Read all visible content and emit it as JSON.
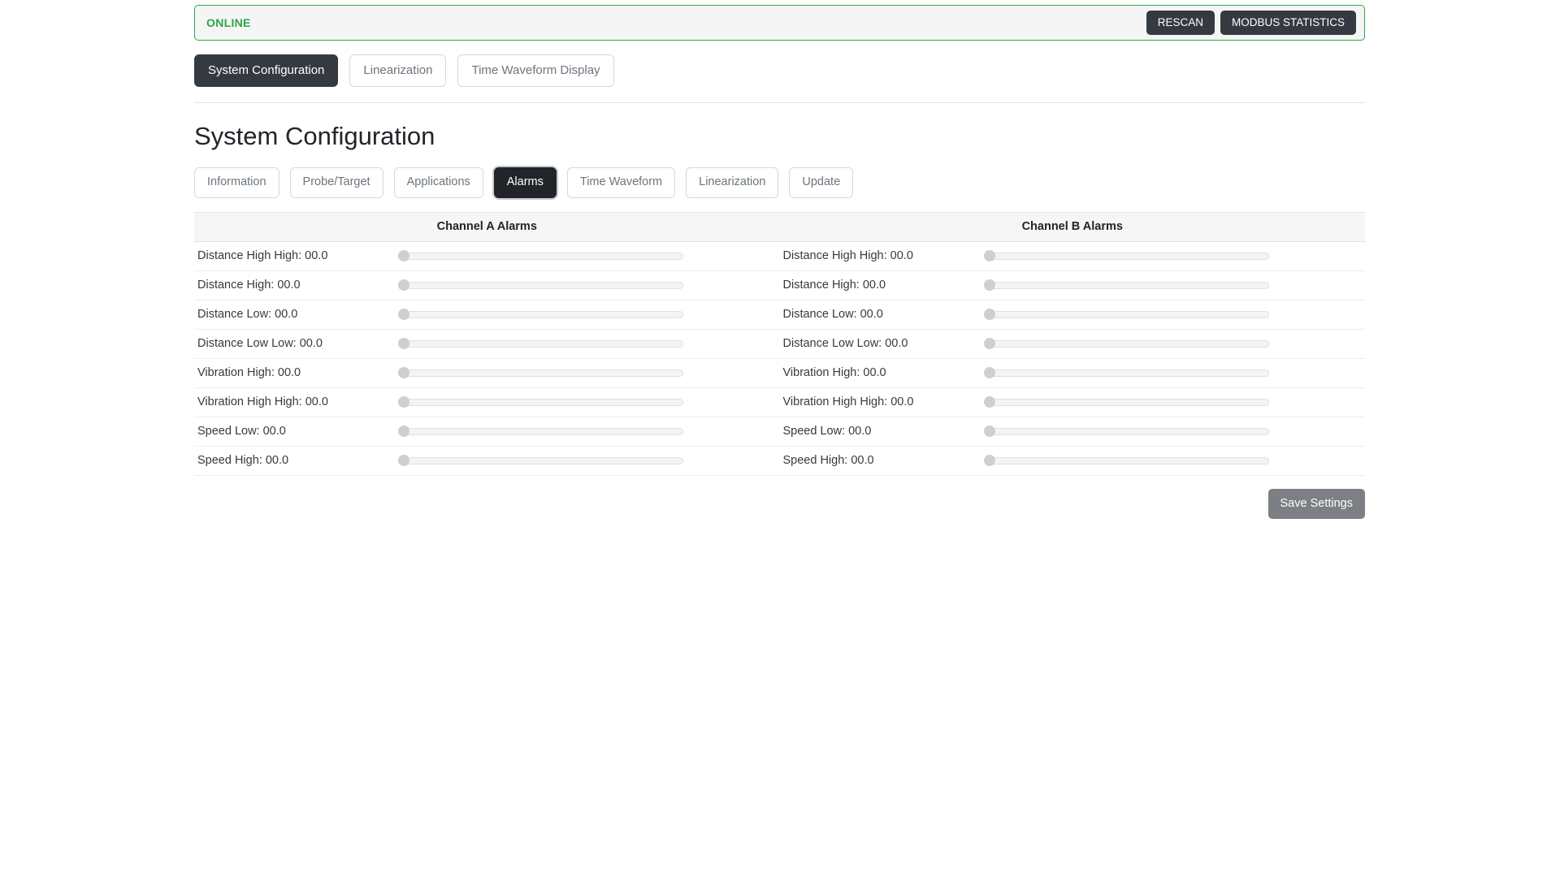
{
  "status": {
    "label": "ONLINE",
    "color": "#28a745",
    "rescan_label": "RESCAN",
    "modbus_label": "MODBUS STATISTICS"
  },
  "primary_nav": [
    {
      "label": "System Configuration",
      "active": true
    },
    {
      "label": "Linearization",
      "active": false
    },
    {
      "label": "Time Waveform Display",
      "active": false
    }
  ],
  "page": {
    "title": "System Configuration"
  },
  "subtabs": [
    {
      "label": "Information",
      "active": false
    },
    {
      "label": "Probe/Target",
      "active": false
    },
    {
      "label": "Applications",
      "active": false
    },
    {
      "label": "Alarms",
      "active": true
    },
    {
      "label": "Time Waveform",
      "active": false
    },
    {
      "label": "Linearization",
      "active": false
    },
    {
      "label": "Update",
      "active": false
    }
  ],
  "alarms": {
    "headers": [
      "Channel A Alarms",
      "Channel B Alarms"
    ],
    "rows": [
      {
        "a_label": "Distance High High: 00.0",
        "a_value": 0,
        "b_label": "Distance High High: 00.0",
        "b_value": 0
      },
      {
        "a_label": "Distance High: 00.0",
        "a_value": 0,
        "b_label": "Distance High: 00.0",
        "b_value": 0
      },
      {
        "a_label": "Distance Low: 00.0",
        "a_value": 0,
        "b_label": "Distance Low: 00.0",
        "b_value": 0
      },
      {
        "a_label": "Distance Low Low: 00.0",
        "a_value": 0,
        "b_label": "Distance Low Low: 00.0",
        "b_value": 0
      },
      {
        "a_label": "Vibration High: 00.0",
        "a_value": 0,
        "b_label": "Vibration High: 00.0",
        "b_value": 0
      },
      {
        "a_label": "Vibration High High: 00.0",
        "a_value": 0,
        "b_label": "Vibration High High: 00.0",
        "b_value": 0
      },
      {
        "a_label": "Speed Low: 00.0",
        "a_value": 0,
        "b_label": "Speed Low: 00.0",
        "b_value": 0
      },
      {
        "a_label": "Speed High: 00.0",
        "a_value": 0,
        "b_label": "Speed High: 00.0",
        "b_value": 0
      }
    ]
  },
  "footer": {
    "save_label": "Save Settings"
  }
}
